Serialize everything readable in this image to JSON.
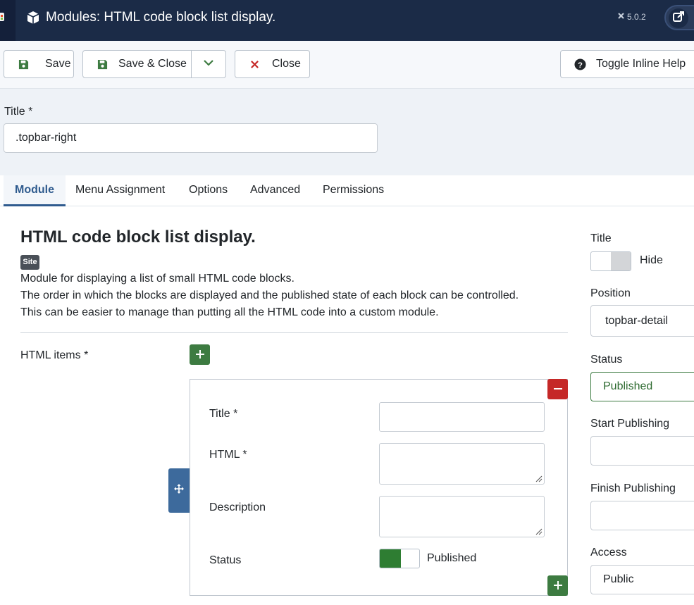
{
  "header": {
    "title": "Modules: HTML code block list display.",
    "version": "5.0.2",
    "icon": "cube-icon"
  },
  "toolbar": {
    "save_label": "Save",
    "save_close_label": "Save & Close",
    "close_label": "Close",
    "help_label": "Toggle Inline Help"
  },
  "title_field": {
    "label": "Title *",
    "value": ".topbar-right"
  },
  "tabs": [
    {
      "label": "Module",
      "active": true
    },
    {
      "label": "Menu Assignment",
      "active": false
    },
    {
      "label": "Options",
      "active": false
    },
    {
      "label": "Advanced",
      "active": false
    },
    {
      "label": "Permissions",
      "active": false
    }
  ],
  "module": {
    "heading": "HTML code block list display.",
    "badge": "Site",
    "description": [
      "Module for displaying a list of small HTML code blocks.",
      "The order in which the blocks are displayed and the published state of each block can be controlled.",
      "This can be easier to manage than putting all the HTML code into a custom module."
    ],
    "items_label": "HTML items *",
    "item": {
      "title_label": "Title *",
      "html_label": "HTML *",
      "description_label": "Description",
      "status_label": "Status",
      "status_value": "Published"
    }
  },
  "sidebar": {
    "title_label": "Title",
    "title_toggle": "Hide",
    "position_label": "Position",
    "position_value": "topbar-detail",
    "status_label": "Status",
    "status_value": "Published",
    "start_label": "Start Publishing",
    "finish_label": "Finish Publishing",
    "access_label": "Access",
    "access_value": "Public"
  },
  "colors": {
    "header_bg": "#1b2b47",
    "active_tab": "#2f5b8e",
    "success": "#3d7b41",
    "danger": "#c52827"
  }
}
